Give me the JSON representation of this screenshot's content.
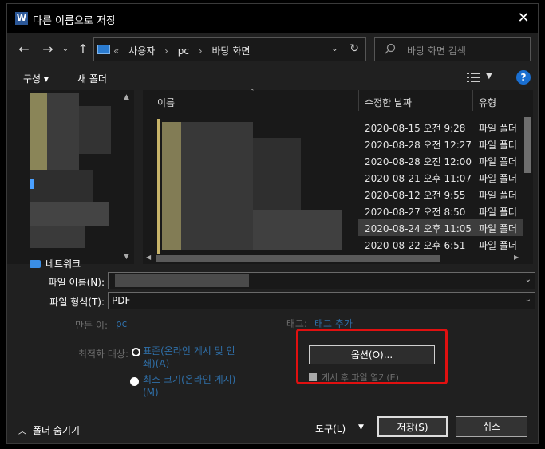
{
  "window": {
    "title": "다른 이름으로 저장",
    "app_icon": "W",
    "close": "✕"
  },
  "address": {
    "crumbs": [
      "«",
      "사용자",
      "›",
      "pc",
      "›",
      "바탕 화면"
    ]
  },
  "search": {
    "placeholder": "바탕 화면 검색"
  },
  "toolbar": {
    "organize": "구성 ▾",
    "new_folder": "새 폴더",
    "help": "?"
  },
  "navpane": {
    "network_label": "네트워크"
  },
  "filelist": {
    "columns": {
      "name": "이름",
      "date": "수정한 날짜",
      "type": "유형"
    },
    "rows": [
      {
        "date": "2020-08-15 오전 9:28",
        "type": "파일 폴더"
      },
      {
        "date": "2020-08-28 오전 12:27",
        "type": "파일 폴더"
      },
      {
        "date": "2020-08-28 오전 12:00",
        "type": "파일 폴더"
      },
      {
        "date": "2020-08-21 오후 11:07",
        "type": "파일 폴더"
      },
      {
        "date": "2020-08-12 오전 9:55",
        "type": "파일 폴더"
      },
      {
        "date": "2020-08-27 오전 8:50",
        "type": "파일 폴더"
      },
      {
        "date": "2020-08-24 오후 11:05",
        "type": "파일 폴더"
      },
      {
        "date": "2020-08-22 오후 6:51",
        "type": "파일 폴더"
      }
    ],
    "selected_index": 6
  },
  "form": {
    "filename_label": "파일 이름(N):",
    "filetype_label": "파일 형식(T):",
    "filetype_value": "PDF",
    "author_label": "만든 이:",
    "author_value": "pc",
    "tags_label": "태그:",
    "tags_value": "태그 추가",
    "optimize_label": "최적화 대상:",
    "optimize_standard": "표준(온라인 게시 및 인쇄)(A)",
    "optimize_minimum": "최소 크기(온라인 게시)(M)",
    "options_button": "옵션(O)...",
    "open_after": "게시 후 파일 열기(E)"
  },
  "footer": {
    "hide_folders": "폴더 숨기기",
    "tools": "도구(L)",
    "save": "저장(S)",
    "cancel": "취소"
  },
  "colors": {
    "accent": "#1a6fd1",
    "highlight": "#e01010",
    "dialog_bg": "#202020"
  }
}
